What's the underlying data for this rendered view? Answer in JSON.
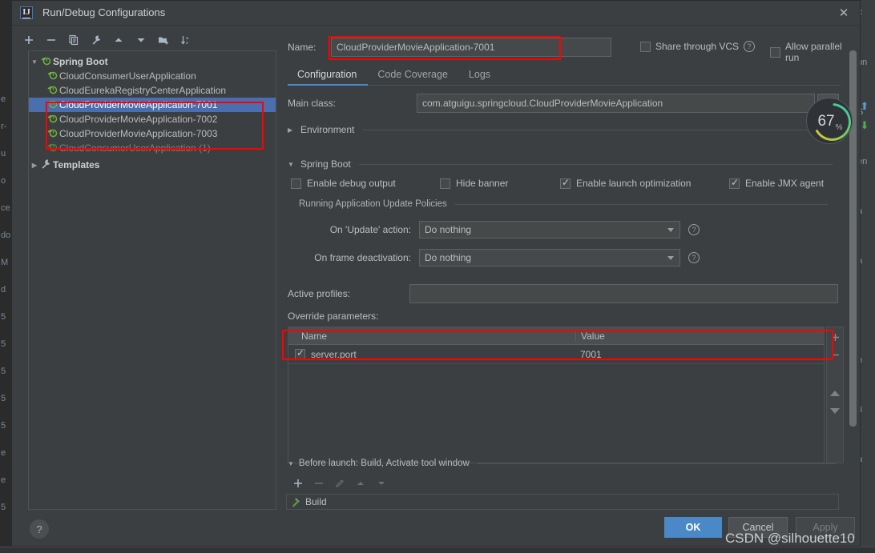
{
  "window": {
    "title": "Run/Debug Configurations",
    "icon": "intellij-idea-icon",
    "close_icon": "close-icon"
  },
  "left_toolbar": {
    "buttons": [
      {
        "name": "add-configuration-button",
        "icon": "plus-icon"
      },
      {
        "name": "remove-configuration-button",
        "icon": "minus-icon"
      },
      {
        "name": "copy-configuration-button",
        "icon": "copy-icon"
      },
      {
        "name": "edit-templates-button",
        "icon": "wrench-icon"
      },
      {
        "name": "move-up-button",
        "icon": "arrow-up-icon"
      },
      {
        "name": "move-down-button",
        "icon": "arrow-down-icon"
      },
      {
        "name": "create-folder-button",
        "icon": "folder-add-icon"
      },
      {
        "name": "sort-configurations-button",
        "icon": "sort-az-icon"
      }
    ]
  },
  "tree": {
    "group_label": "Spring Boot",
    "items": [
      {
        "label": "CloudConsumerUserApplication",
        "selected": false,
        "dim": false
      },
      {
        "label": "CloudEurekaRegistryCenterApplication",
        "selected": false,
        "dim": false
      },
      {
        "label": "CloudProviderMovieApplication-7001",
        "selected": true,
        "dim": false
      },
      {
        "label": "CloudProviderMovieApplication-7002",
        "selected": false,
        "dim": false
      },
      {
        "label": "CloudProviderMovieApplication-7003",
        "selected": false,
        "dim": false
      },
      {
        "label": "CloudConsumerUserApplication (1)",
        "selected": false,
        "dim": true
      }
    ],
    "templates_label": "Templates"
  },
  "name_row": {
    "label": "Name:",
    "value": "CloudProviderMovieApplication-7001",
    "share_label": "Share through VCS",
    "share_checked": false,
    "share_help_icon": "help-icon",
    "allow_parallel_label": "Allow parallel run",
    "allow_parallel_checked": false
  },
  "tabs": [
    {
      "label": "Configuration",
      "active": true
    },
    {
      "label": "Code Coverage",
      "active": false
    },
    {
      "label": "Logs",
      "active": false
    }
  ],
  "main_class": {
    "label": "Main class:",
    "value": "com.atguigu.springcloud.CloudProviderMovieApplication",
    "browse_icon": "browse-icon"
  },
  "environment_section": {
    "label": "Environment",
    "expanded": false,
    "triangle_icon": "chevron-right-icon"
  },
  "spring_boot_section": {
    "label": "Spring Boot",
    "expanded": true,
    "triangle_icon": "chevron-down-icon",
    "checkboxes": [
      {
        "label": "Enable debug output",
        "checked": false
      },
      {
        "label": "Hide banner",
        "checked": false
      },
      {
        "label": "Enable launch optimization",
        "checked": true
      },
      {
        "label": "Enable JMX agent",
        "checked": true
      }
    ]
  },
  "update_policies": {
    "section_label": "Running Application Update Policies",
    "rows": [
      {
        "label": "On 'Update' action:",
        "value": "Do nothing",
        "help_icon": "help-icon"
      },
      {
        "label": "On frame deactivation:",
        "value": "Do nothing",
        "help_icon": "help-icon"
      }
    ]
  },
  "active_profiles": {
    "label": "Active profiles:",
    "value": "",
    "placeholder": ""
  },
  "override_parameters": {
    "label": "Override parameters:",
    "columns": [
      "Name",
      "Value"
    ],
    "rows": [
      {
        "checked": true,
        "name": "server.port",
        "value": "7001"
      }
    ],
    "side_buttons": [
      {
        "name": "add-parameter-button",
        "icon": "plus-icon"
      },
      {
        "name": "remove-parameter-button",
        "icon": "minus-icon"
      },
      {
        "name": "move-parameter-up-button",
        "icon": "triangle-up-icon"
      },
      {
        "name": "move-parameter-down-button",
        "icon": "triangle-down-icon"
      }
    ]
  },
  "before_launch": {
    "label": "Before launch: Build, Activate tool window",
    "triangle_icon": "chevron-down-icon",
    "toolbar": [
      {
        "name": "add-task-button",
        "icon": "plus-icon",
        "enabled": true
      },
      {
        "name": "remove-task-button",
        "icon": "minus-icon",
        "enabled": false
      },
      {
        "name": "edit-task-button",
        "icon": "pencil-icon",
        "enabled": false
      },
      {
        "name": "task-move-up-button",
        "icon": "arrow-up-icon",
        "enabled": false
      },
      {
        "name": "task-move-down-button",
        "icon": "arrow-down-icon",
        "enabled": false
      }
    ],
    "tasks": [
      {
        "label": "Build",
        "icon": "hammer-icon"
      }
    ]
  },
  "buttons": {
    "ok": "OK",
    "cancel": "Cancel",
    "apply": "Apply",
    "help": "?"
  },
  "gauge": {
    "value": "67",
    "unit": "%",
    "percent": 67,
    "arc_colors": [
      "#35c8b2",
      "#6fcf59",
      "#e8c338"
    ],
    "up_arrow_icon": "arrow-up-icon",
    "down_arrow_icon": "arrow-down-icon"
  },
  "watermark": "CSDN @silhouette10",
  "colors": {
    "dialog_bg": "#3c3f41",
    "field_bg": "#45494a",
    "selection_blue": "#4b6eaf",
    "accent_blue": "#4a88c7",
    "highlight_red": "#ff0000",
    "text": "#bbbbbb"
  },
  "ide_background": {
    "left_fragments": [
      "e",
      "r-",
      "u",
      "o",
      "ce",
      "do",
      "M",
      "d",
      "5",
      "5",
      "5",
      "5",
      "5",
      "e",
      "e",
      "5"
    ],
    "right_fragments": [
      "<",
      "un",
      "S",
      "en",
      "a",
      "a",
      "r",
      "h",
      "4",
      "a"
    ]
  }
}
